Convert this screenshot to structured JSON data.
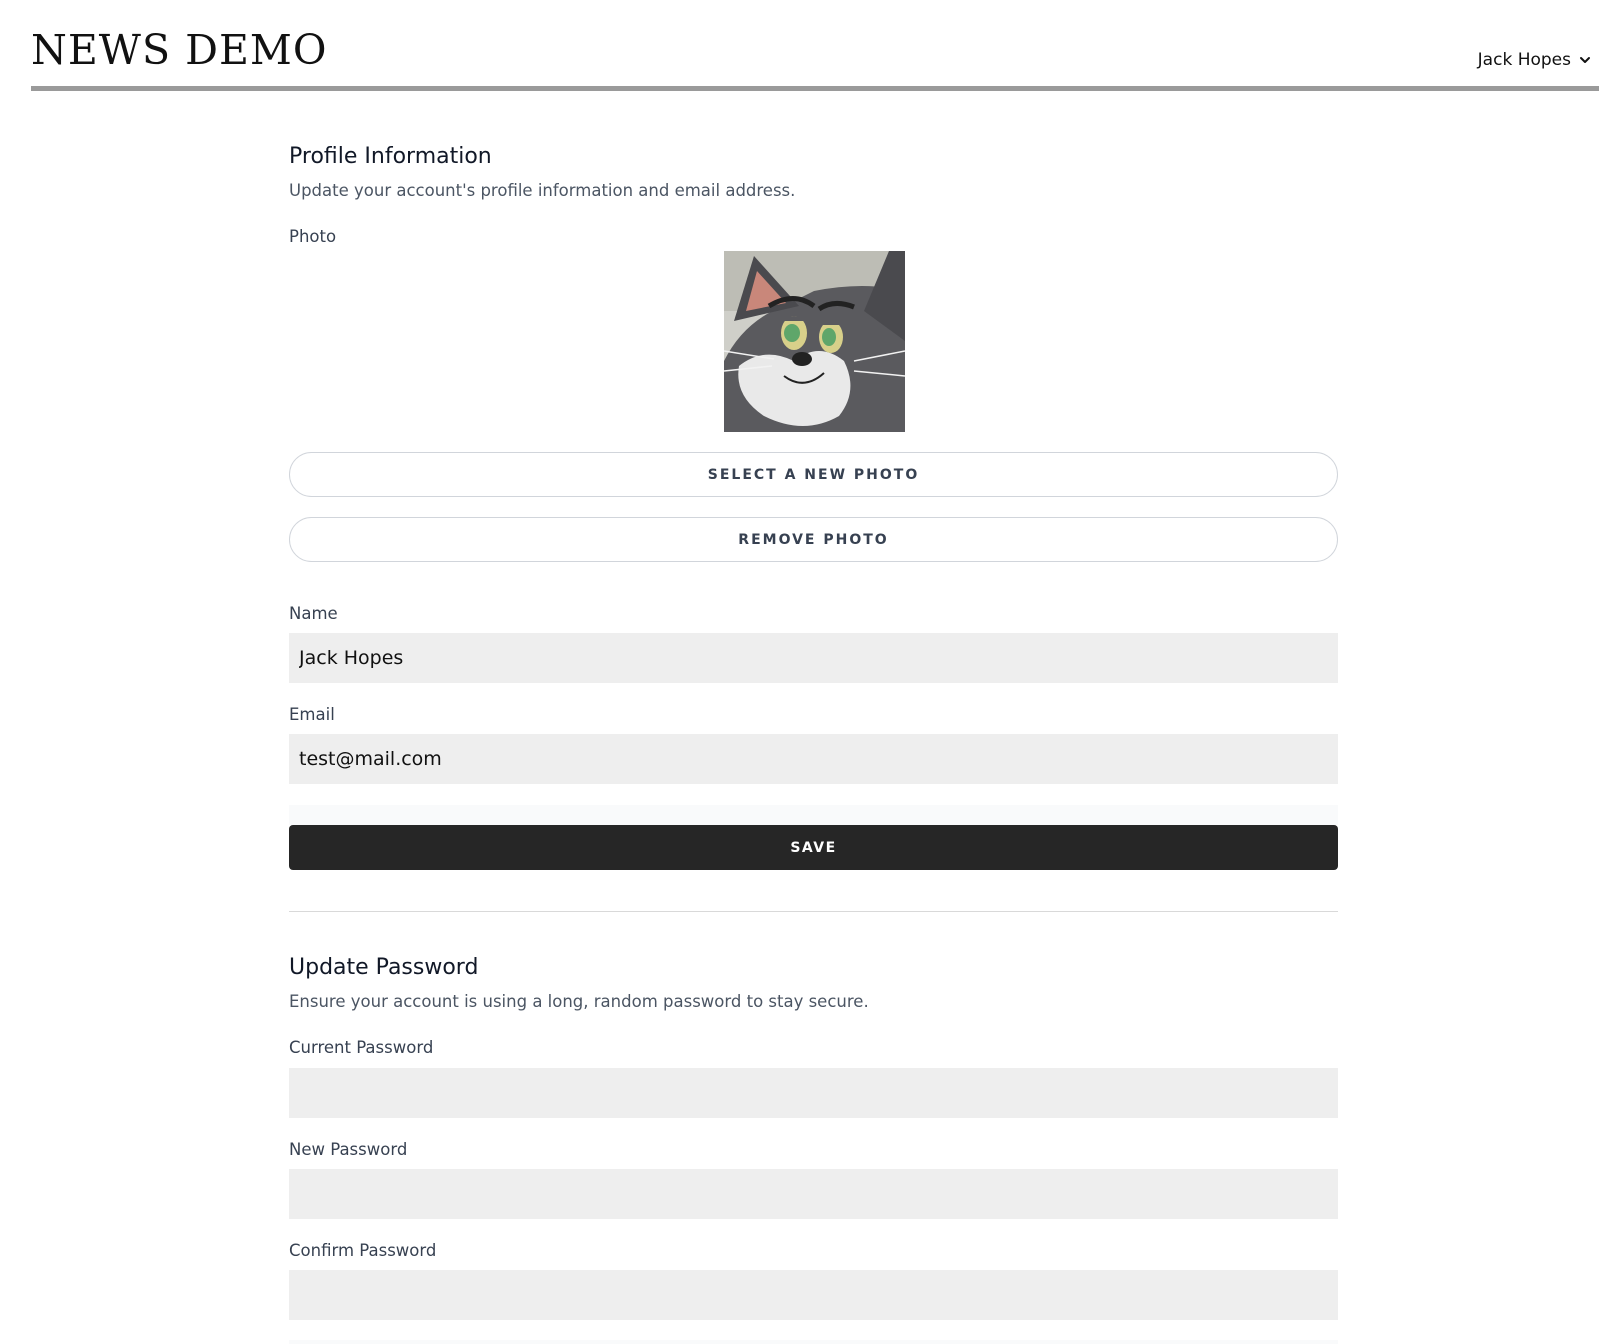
{
  "header": {
    "logo": "NEWS DEMO",
    "user_name": "Jack Hopes"
  },
  "profile": {
    "title": "Profile Information",
    "description": "Update your account's profile information and email address.",
    "photo_label": "Photo",
    "select_photo_label": "SELECT A NEW PHOTO",
    "remove_photo_label": "REMOVE PHOTO",
    "name_label": "Name",
    "name_value": "Jack Hopes",
    "email_label": "Email",
    "email_value": "test@mail.com",
    "save_label": "SAVE"
  },
  "password": {
    "title": "Update Password",
    "description": "Ensure your account is using a long, random password to stay secure.",
    "current_label": "Current Password",
    "current_value": "",
    "new_label": "New Password",
    "new_value": "",
    "confirm_label": "Confirm Password",
    "confirm_value": ""
  },
  "colors": {
    "header_rule": "#9a9a9a",
    "input_bg": "#eeeeee",
    "primary_button": "#262626"
  },
  "icons": {
    "user_menu": "chevron-down-icon",
    "avatar": "cat-avatar"
  }
}
